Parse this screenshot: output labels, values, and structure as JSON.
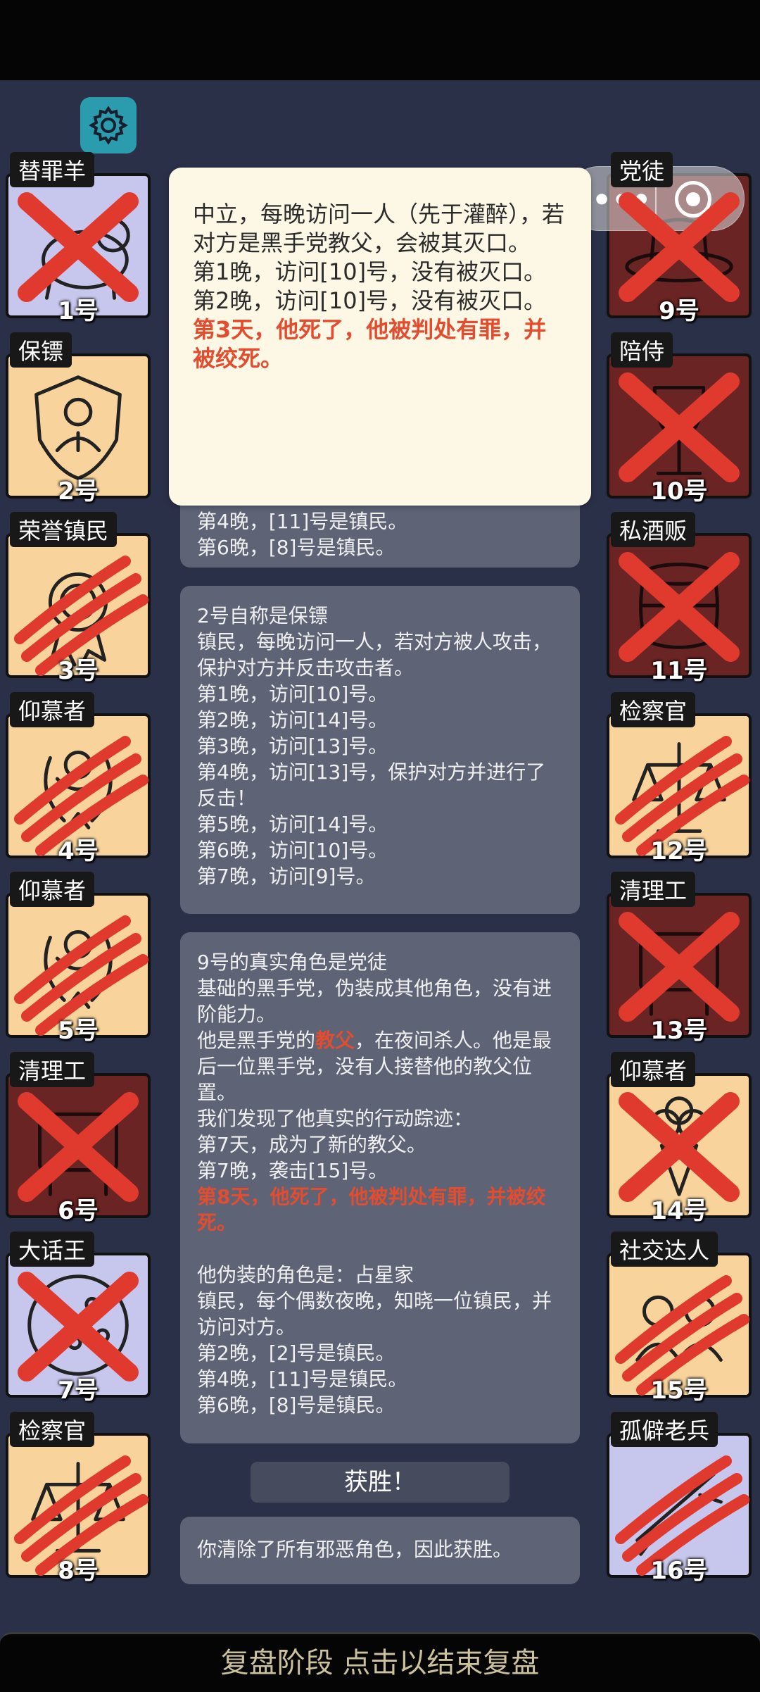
{
  "colors": {
    "villager_bg": "#f8d49c",
    "neutral_bg": "#c7c6ec",
    "mafia_bg": "#6b2424",
    "mark_red": "#e03a2f"
  },
  "settings": {
    "icon": "gear-icon"
  },
  "capsule": {
    "more": "•••"
  },
  "players": [
    {
      "num": "1号",
      "role": "替罪羊",
      "type": "neutral",
      "mark": "x",
      "icon": "sheep"
    },
    {
      "num": "2号",
      "role": "保镖",
      "type": "villager",
      "mark": "none",
      "icon": "shield-person"
    },
    {
      "num": "3号",
      "role": "荣誉镇民",
      "type": "villager",
      "mark": "claw",
      "icon": "medal"
    },
    {
      "num": "4号",
      "role": "仰慕者",
      "type": "villager",
      "mark": "claw",
      "icon": "wreath"
    },
    {
      "num": "5号",
      "role": "仰慕者",
      "type": "villager",
      "mark": "claw",
      "icon": "wreath"
    },
    {
      "num": "6号",
      "role": "清理工",
      "type": "mafia",
      "mark": "x",
      "icon": "cart"
    },
    {
      "num": "7号",
      "role": "大话王",
      "type": "neutral",
      "mark": "x",
      "icon": "pizza"
    },
    {
      "num": "8号",
      "role": "检察官",
      "type": "villager",
      "mark": "claw",
      "icon": "scales"
    },
    {
      "num": "9号",
      "role": "党徒",
      "type": "mafia",
      "mark": "x",
      "icon": "hat"
    },
    {
      "num": "10号",
      "role": "陪侍",
      "type": "mafia",
      "mark": "x",
      "icon": "glass"
    },
    {
      "num": "11号",
      "role": "私酒贩",
      "type": "mafia",
      "mark": "x",
      "icon": "barrel"
    },
    {
      "num": "12号",
      "role": "检察官",
      "type": "villager",
      "mark": "claw",
      "icon": "scales"
    },
    {
      "num": "13号",
      "role": "清理工",
      "type": "mafia",
      "mark": "x",
      "icon": "cart"
    },
    {
      "num": "14号",
      "role": "仰慕者",
      "type": "villager",
      "mark": "x",
      "icon": "bouquet"
    },
    {
      "num": "15号",
      "role": "社交达人",
      "type": "villager",
      "mark": "claw",
      "icon": "people"
    },
    {
      "num": "16号",
      "role": "孤僻老兵",
      "type": "neutral",
      "mark": "claw",
      "icon": "rifle"
    }
  ],
  "tooltip": {
    "lines": [
      "中立，每晚访问一人（先于灌醉），若对方是黑手党教父，会被其灭口。",
      "第1晚，访问[10]号，没有被灭口。",
      "第2晚，访问[10]号，没有被灭口。"
    ],
    "death": "第3天，他死了，他被判处有罪，并被绞死。"
  },
  "panel1": {
    "lines": [
      "第4晚，[11]号是镇民。",
      "第6晚，[8]号是镇民。"
    ]
  },
  "panel2": {
    "lines": [
      "2号自称是保镖",
      "镇民，每晚访问一人，若对方被人攻击，保护对方并反击攻击者。",
      "第1晚，访问[10]号。",
      "第2晚，访问[14]号。",
      "第3晚，访问[13]号。",
      "第4晚，访问[13]号，保护对方并进行了反击！",
      "第5晚，访问[14]号。",
      "第6晚，访问[10]号。",
      "第7晚，访问[9]号。"
    ]
  },
  "panel3": {
    "line1": "9号的真实角色是党徒",
    "line2": "基础的黑手党，伪装成其他角色，没有进阶能力。",
    "line3_pre": "他是黑手党的",
    "line3_red": "教父",
    "line3_post": "，在夜间杀人。他是最后一位黑手党，没有人接替他的教父位置。",
    "line4": "我们发现了他真实的行动踪迹：",
    "line5": "第7天，成为了新的教父。",
    "line6": "第7晚，袭击[15]号。",
    "death": "第8天，他死了，他被判处有罪，并被绞死。",
    "disguise": [
      "他伪装的角色是：占星家",
      "镇民，每个偶数夜晚，知晓一位镇民，并访问对方。",
      "第2晚，[2]号是镇民。",
      "第4晚，[11]号是镇民。",
      "第6晚，[8]号是镇民。"
    ]
  },
  "win": {
    "label": "获胜！"
  },
  "panel4": {
    "text": "你清除了所有邪恶角色，因此获胜。"
  },
  "footer": {
    "text": "复盘阶段 点击以结束复盘"
  }
}
